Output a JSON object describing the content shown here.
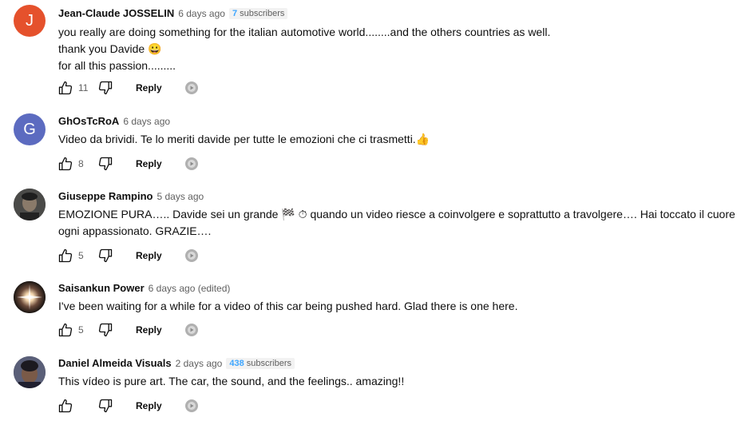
{
  "comments": [
    {
      "author": "Jean-Claude JOSSELIN",
      "time": "6 days ago",
      "subscribers_count": "7",
      "subscribers_label": "subscribers",
      "avatar_letter": "J",
      "avatar_color": "#e5512c",
      "lines": [
        "you really are doing something for the italian automotive world........and the others countries as well.",
        "thank you Davide 😀",
        "for all this passion........."
      ],
      "likes": "11",
      "reply_label": "Reply"
    },
    {
      "author": "GhOsTcRoA",
      "time": "6 days ago",
      "avatar_letter": "G",
      "avatar_color": "#5c6bc0",
      "lines": [
        "Video da brividi. Te lo meriti davide per tutte le emozioni che ci trasmetti.👍"
      ],
      "likes": "8",
      "reply_label": "Reply"
    },
    {
      "author": "Giuseppe Rampino",
      "time": "5 days ago",
      "avatar_letter": "",
      "avatar_color": "#3a3a3a",
      "lines": [
        "EMOZIONE PURA….. Davide sei un grande 🏁 ⏱ quando un video riesce a coinvolgere e soprattutto a travolgere…. Hai toccato il cuore di",
        "ogni appassionato. GRAZIE…."
      ],
      "likes": "5",
      "reply_label": "Reply"
    },
    {
      "author": "Saisankun Power",
      "time": "6 days ago (edited)",
      "avatar_letter": "",
      "avatar_color": "#2b2420",
      "lines": [
        "I've been waiting for a while for a video of this car being pushed hard. Glad there is one here."
      ],
      "likes": "5",
      "reply_label": "Reply"
    },
    {
      "author": "Daniel Almeida Visuals",
      "time": "2 days ago",
      "subscribers_count": "438",
      "subscribers_label": "subscribers",
      "avatar_letter": "",
      "avatar_color": "#3b3f52",
      "lines": [
        "This vídeo is pure art. The car, the sound, and the feelings.. amazing!!"
      ],
      "likes": "",
      "reply_label": "Reply"
    }
  ],
  "icons": {
    "like": "thumb-up-icon",
    "dislike": "thumb-down-icon",
    "creator": "creator-reply-icon"
  }
}
